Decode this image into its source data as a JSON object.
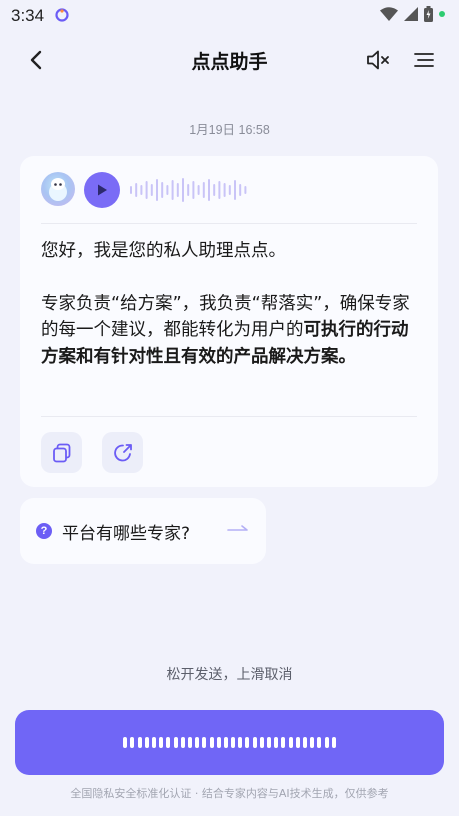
{
  "status_bar": {
    "time": "3:34"
  },
  "nav": {
    "title": "点点助手"
  },
  "chat": {
    "timestamp": "1月19日 16:58",
    "message": {
      "line1": "您好，我是您的私人助理点点。",
      "line2_plain": "专家负责“给方案”，我负责“帮落实”，确保专家的每一个建议，都能转化为用户的",
      "line2_bold": "可执行的行动方案和有针对性且有效的产品解决方案。"
    }
  },
  "suggestion": {
    "text": "平台有哪些专家?"
  },
  "voice": {
    "release_hint": "松开发送，上滑取消"
  },
  "footer": {
    "text": "全国隐私安全标准化认证 · 结合专家内容与AI技术生成，仅供参考"
  },
  "colors": {
    "accent": "#7066f6",
    "background": "#f1f2fb",
    "card": "#fafbff"
  },
  "icons": [
    "back-arrow-icon",
    "mute-icon",
    "menu-icon",
    "play-icon",
    "copy-icon",
    "share-icon",
    "question-icon",
    "arrow-right-icon"
  ]
}
